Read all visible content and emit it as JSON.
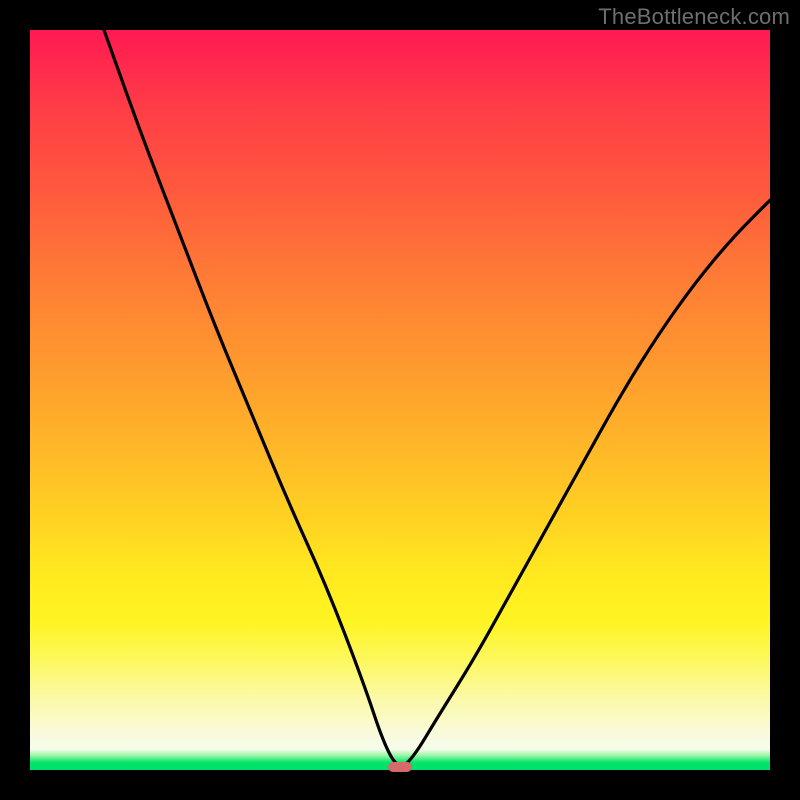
{
  "watermark": "TheBottleneck.com",
  "chart_data": {
    "type": "line",
    "title": "",
    "xlabel": "",
    "ylabel": "",
    "xlim": [
      0,
      100
    ],
    "ylim": [
      0,
      100
    ],
    "grid": false,
    "legend": false,
    "series": [
      {
        "name": "curve",
        "x": [
          10,
          15,
          20,
          25,
          30,
          35,
          40,
          45,
          48,
          50,
          52,
          55,
          60,
          65,
          70,
          75,
          80,
          85,
          90,
          95,
          100
        ],
        "values": [
          100,
          86,
          73,
          60,
          48,
          36,
          25,
          12,
          3,
          0,
          2,
          7,
          15,
          24,
          33,
          42,
          51,
          59,
          66,
          72,
          77
        ]
      }
    ],
    "minimum_marker": {
      "x": 50,
      "y": 0
    },
    "background_gradient": [
      "#ff1a53",
      "#ffea1f",
      "#f9fadb",
      "#00e06a"
    ]
  }
}
